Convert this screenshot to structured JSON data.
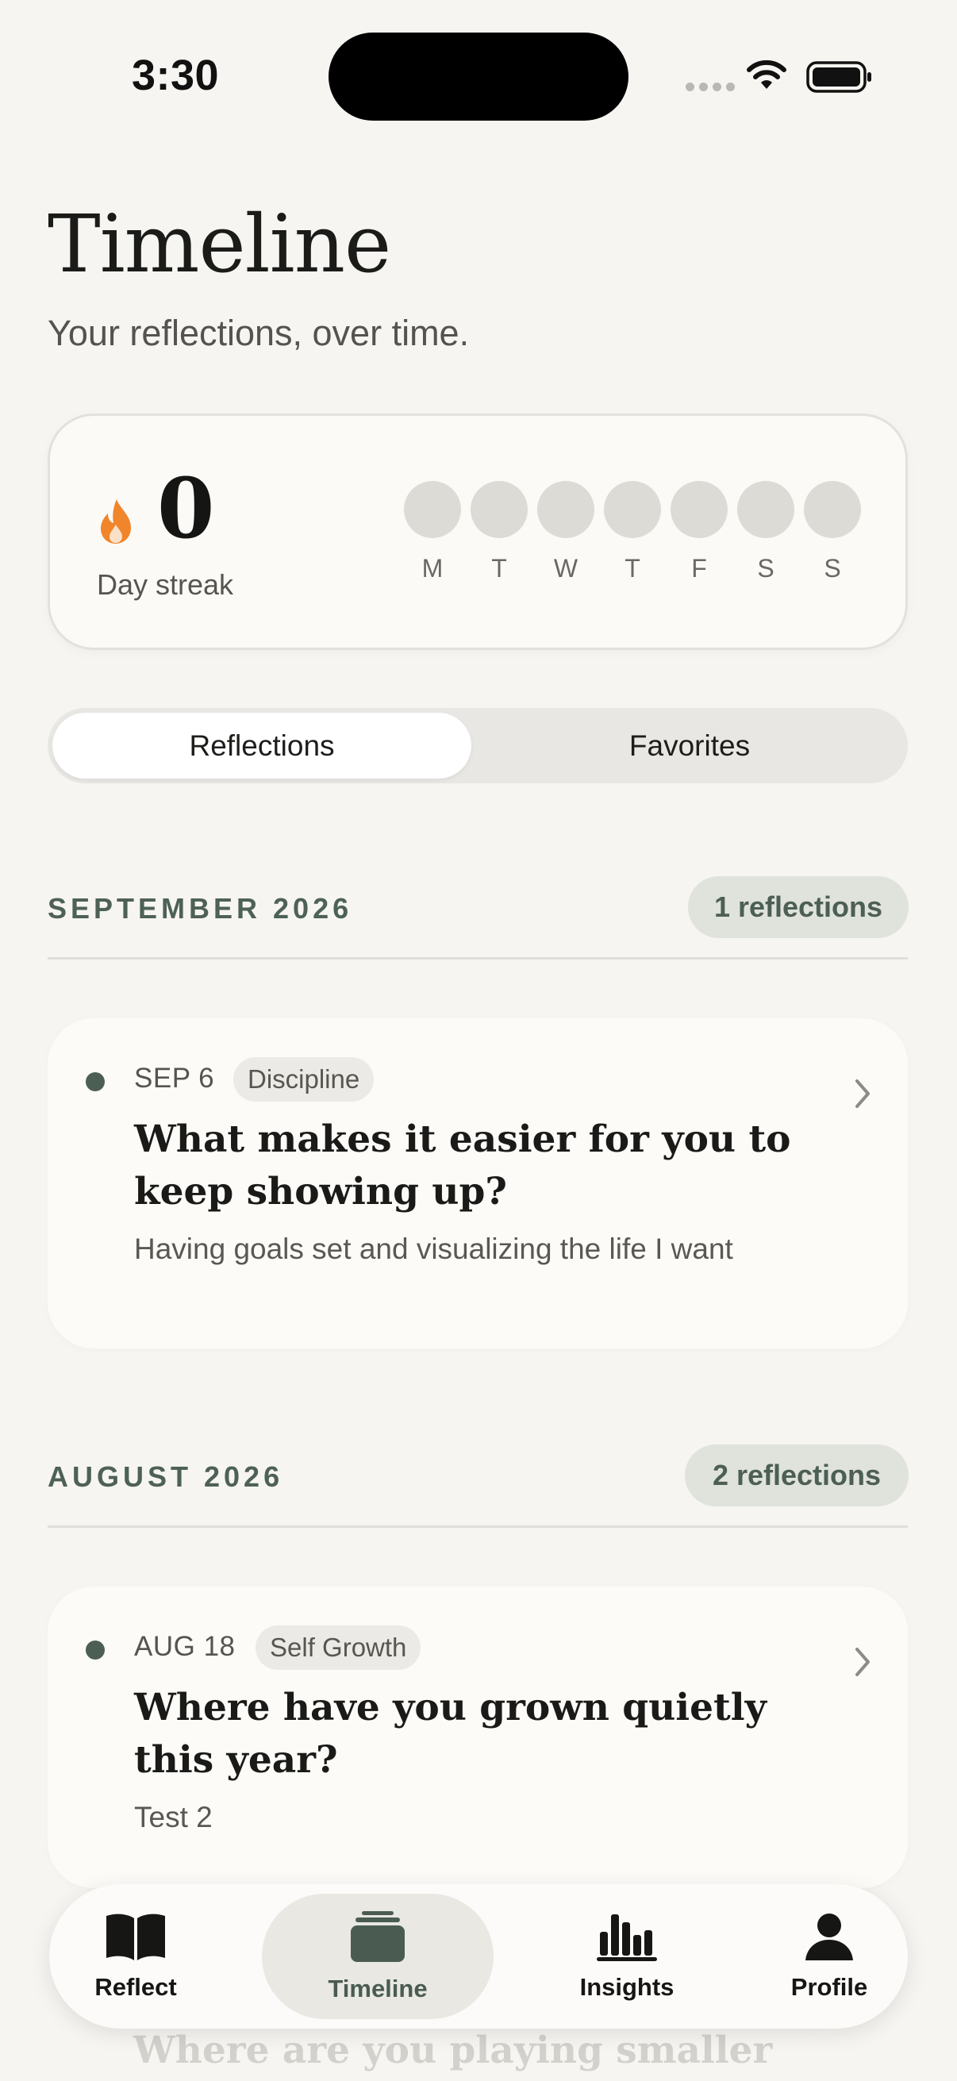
{
  "status_bar": {
    "time": "3:30"
  },
  "header": {
    "title": "Timeline",
    "subtitle": "Your reflections, over time."
  },
  "streak": {
    "count": "0",
    "label": "Day streak",
    "days": [
      "M",
      "T",
      "W",
      "T",
      "F",
      "S",
      "S"
    ],
    "flame_color": "#f0852b"
  },
  "segmented": {
    "active": "Reflections",
    "inactive": "Favorites"
  },
  "sections": [
    {
      "month": "SEPTEMBER 2026",
      "count_label": "1 reflections",
      "entries": [
        {
          "date": "SEP 6",
          "tag": "Discipline",
          "question": "What makes it easier for you to keep showing up?",
          "answer": "Having goals set and visualizing the life I want"
        }
      ]
    },
    {
      "month": "AUGUST 2026",
      "count_label": "2 reflections",
      "entries": [
        {
          "date": "AUG 18",
          "tag": "Self Growth",
          "question": "Where have you grown quietly this year?",
          "answer": "Test 2"
        },
        {
          "question": "Where are you playing smaller"
        }
      ]
    }
  ],
  "tabbar": {
    "items": [
      {
        "label": "Reflect",
        "icon": "book-icon"
      },
      {
        "label": "Timeline",
        "icon": "stack-icon"
      },
      {
        "label": "Insights",
        "icon": "bar-chart-icon"
      },
      {
        "label": "Profile",
        "icon": "person-icon"
      }
    ],
    "active": "Timeline"
  },
  "colors": {
    "background": "#f6f5f1",
    "accent": "#4c5f55",
    "card": "#fcfbf8"
  }
}
